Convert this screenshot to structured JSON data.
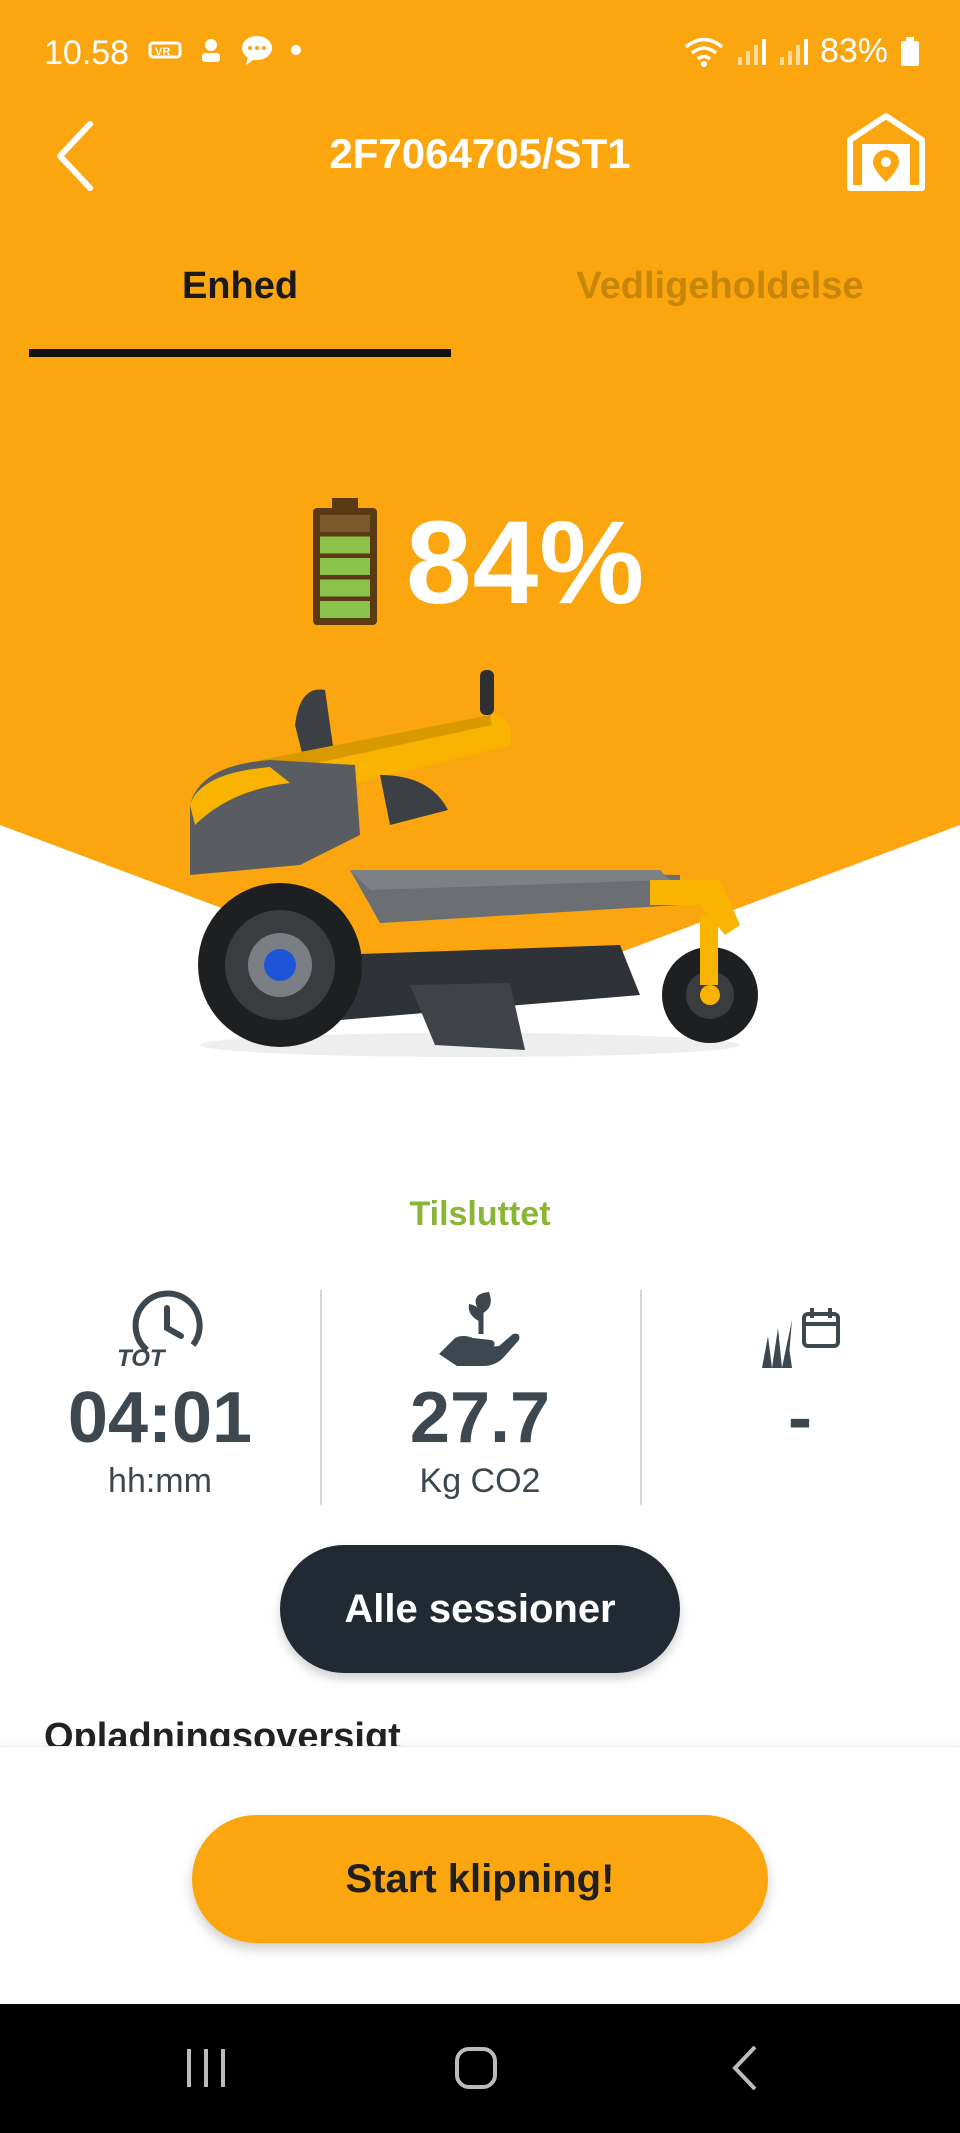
{
  "colors": {
    "accent": "#FBA60F",
    "dark": "#212A33",
    "connected": "#8BB534",
    "tab_inactive": "#C6860A"
  },
  "status_bar": {
    "time": "10.58",
    "battery": "83%",
    "icons": [
      "vr-icon",
      "person-icon",
      "chat-bubble-icon",
      "dot-icon",
      "wifi-icon",
      "signal-icon",
      "signal-icon",
      "battery-icon"
    ]
  },
  "header": {
    "title": "2F7064705/ST1",
    "back_icon": "chevron-left-icon",
    "garage_icon": "garage-location-icon"
  },
  "tabs": [
    {
      "label": "Enhed",
      "active": true
    },
    {
      "label": "Vedligeholdelse",
      "active": false
    }
  ],
  "battery": {
    "percent_text": "84%",
    "level": 0.84
  },
  "connection_status": "Tilsluttet",
  "stats": [
    {
      "icon": "clock-tot-icon",
      "value": "04:01",
      "unit": "hh:mm"
    },
    {
      "icon": "hand-plant-co2-icon",
      "value": "27.7",
      "unit": "Kg CO2"
    },
    {
      "icon": "grass-calendar-icon",
      "value": "-",
      "unit": ""
    }
  ],
  "buttons": {
    "all_sessions": "Alle sessioner",
    "start_mowing": "Start klipning!"
  },
  "section_heading": "Opladningsoversigt",
  "nav_bar": [
    "recent-apps-icon",
    "home-icon",
    "back-icon"
  ]
}
